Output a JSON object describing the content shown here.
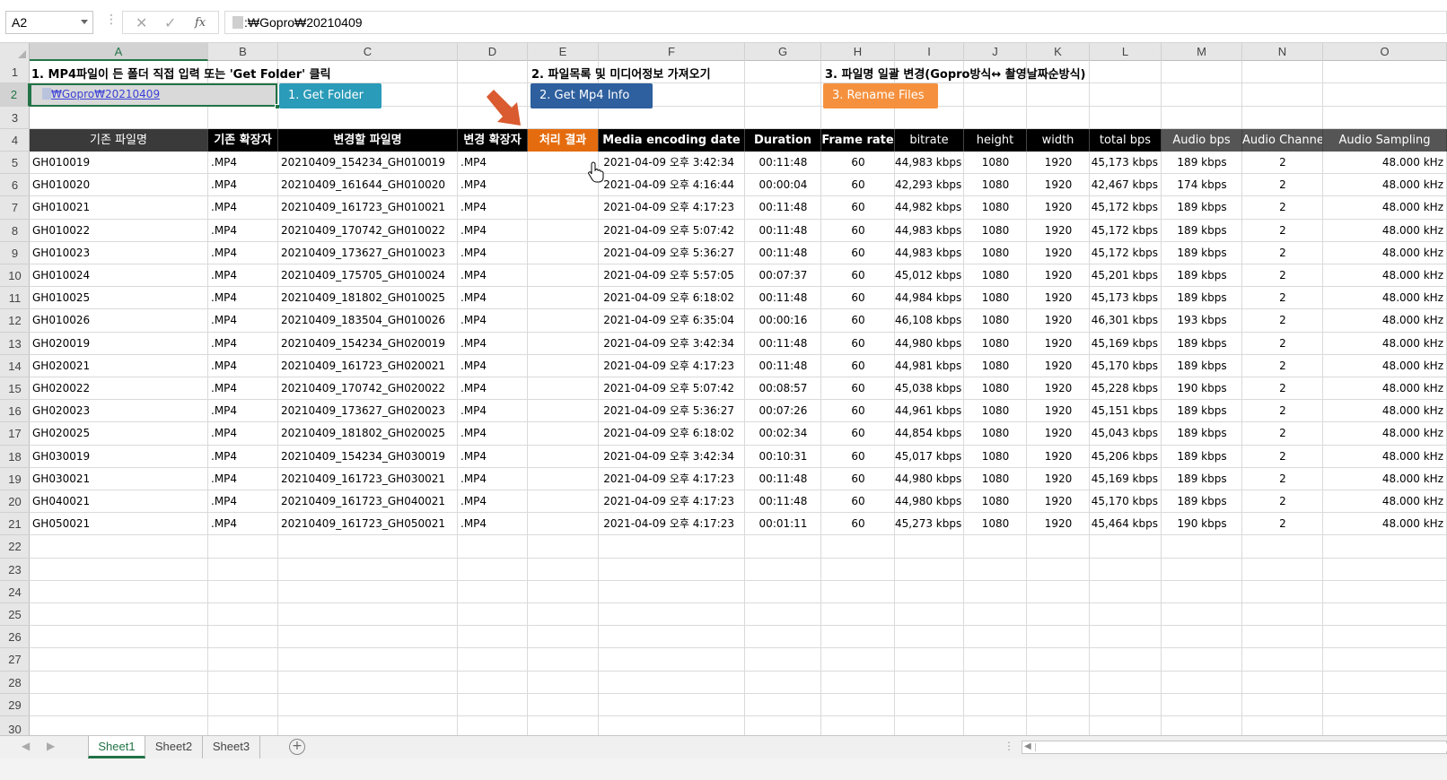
{
  "formula_bar": {
    "name_box": "A2",
    "formula": ":₩Gopro₩20210409",
    "cancel_icon": "✕",
    "enter_icon": "✓",
    "fx_icon": "fx"
  },
  "column_headers": [
    "A",
    "B",
    "C",
    "D",
    "E",
    "F",
    "G",
    "H",
    "I",
    "J",
    "K",
    "L",
    "M",
    "N",
    "O"
  ],
  "selected_column": "A",
  "row_numbers": [
    "1",
    "2",
    "3",
    "4",
    "5",
    "6",
    "7",
    "8",
    "9",
    "10",
    "11",
    "12",
    "13",
    "14",
    "15",
    "16",
    "17",
    "18",
    "19",
    "20",
    "21",
    "22",
    "23",
    "24",
    "25",
    "26",
    "27",
    "28",
    "29",
    "30"
  ],
  "selected_row": "2",
  "sections": {
    "step1": "1. MP4파일이 든 폴더 직접 입력 또는 'Get Folder' 클릭",
    "step2": "2. 파일목록 및 미디어정보 가져오기",
    "step3": "3. 파일명 일괄 변경(Gopro방식↔ 촬영날짜순방식)"
  },
  "a2_value": "₩Gopro₩20210409",
  "buttons": {
    "get_folder": "1. Get Folder",
    "get_mp4_info": "2. Get Mp4 Info",
    "rename_files": "3. Rename Files"
  },
  "table_headers": {
    "orig_name": "기존 파일명",
    "orig_ext": "기존 확장자",
    "new_name": "변경할 파일명",
    "new_ext": "변경 확장자",
    "result": "처리 결과",
    "media_date": "Media encoding date",
    "duration": "Duration",
    "frame_rate": "Frame rate",
    "bitrate": "bitrate",
    "height": "height",
    "width": "width",
    "total_bps": "total bps",
    "audio_bps": "Audio bps",
    "audio_channel": "Audio Channel",
    "audio_sampling": "Audio Sampling"
  },
  "rows": [
    [
      "GH010019",
      ".MP4",
      "20210409_154234_GH010019",
      ".MP4",
      "",
      "2021-04-09 오후 3:42:34",
      "00:11:48",
      "60",
      "44,983 kbps",
      "1080",
      "1920",
      "45,173 kbps",
      "189 kbps",
      "2",
      "48.000 kHz"
    ],
    [
      "GH010020",
      ".MP4",
      "20210409_161644_GH010020",
      ".MP4",
      "",
      "2021-04-09 오후 4:16:44",
      "00:00:04",
      "60",
      "42,293 kbps",
      "1080",
      "1920",
      "42,467 kbps",
      "174 kbps",
      "2",
      "48.000 kHz"
    ],
    [
      "GH010021",
      ".MP4",
      "20210409_161723_GH010021",
      ".MP4",
      "",
      "2021-04-09 오후 4:17:23",
      "00:11:48",
      "60",
      "44,982 kbps",
      "1080",
      "1920",
      "45,172 kbps",
      "189 kbps",
      "2",
      "48.000 kHz"
    ],
    [
      "GH010022",
      ".MP4",
      "20210409_170742_GH010022",
      ".MP4",
      "",
      "2021-04-09 오후 5:07:42",
      "00:11:48",
      "60",
      "44,983 kbps",
      "1080",
      "1920",
      "45,172 kbps",
      "189 kbps",
      "2",
      "48.000 kHz"
    ],
    [
      "GH010023",
      ".MP4",
      "20210409_173627_GH010023",
      ".MP4",
      "",
      "2021-04-09 오후 5:36:27",
      "00:11:48",
      "60",
      "44,983 kbps",
      "1080",
      "1920",
      "45,172 kbps",
      "189 kbps",
      "2",
      "48.000 kHz"
    ],
    [
      "GH010024",
      ".MP4",
      "20210409_175705_GH010024",
      ".MP4",
      "",
      "2021-04-09 오후 5:57:05",
      "00:07:37",
      "60",
      "45,012 kbps",
      "1080",
      "1920",
      "45,201 kbps",
      "189 kbps",
      "2",
      "48.000 kHz"
    ],
    [
      "GH010025",
      ".MP4",
      "20210409_181802_GH010025",
      ".MP4",
      "",
      "2021-04-09 오후 6:18:02",
      "00:11:48",
      "60",
      "44,984 kbps",
      "1080",
      "1920",
      "45,173 kbps",
      "189 kbps",
      "2",
      "48.000 kHz"
    ],
    [
      "GH010026",
      ".MP4",
      "20210409_183504_GH010026",
      ".MP4",
      "",
      "2021-04-09 오후 6:35:04",
      "00:00:16",
      "60",
      "46,108 kbps",
      "1080",
      "1920",
      "46,301 kbps",
      "193 kbps",
      "2",
      "48.000 kHz"
    ],
    [
      "GH020019",
      ".MP4",
      "20210409_154234_GH020019",
      ".MP4",
      "",
      "2021-04-09 오후 3:42:34",
      "00:11:48",
      "60",
      "44,980 kbps",
      "1080",
      "1920",
      "45,169 kbps",
      "189 kbps",
      "2",
      "48.000 kHz"
    ],
    [
      "GH020021",
      ".MP4",
      "20210409_161723_GH020021",
      ".MP4",
      "",
      "2021-04-09 오후 4:17:23",
      "00:11:48",
      "60",
      "44,981 kbps",
      "1080",
      "1920",
      "45,170 kbps",
      "189 kbps",
      "2",
      "48.000 kHz"
    ],
    [
      "GH020022",
      ".MP4",
      "20210409_170742_GH020022",
      ".MP4",
      "",
      "2021-04-09 오후 5:07:42",
      "00:08:57",
      "60",
      "45,038 kbps",
      "1080",
      "1920",
      "45,228 kbps",
      "190 kbps",
      "2",
      "48.000 kHz"
    ],
    [
      "GH020023",
      ".MP4",
      "20210409_173627_GH020023",
      ".MP4",
      "",
      "2021-04-09 오후 5:36:27",
      "00:07:26",
      "60",
      "44,961 kbps",
      "1080",
      "1920",
      "45,151 kbps",
      "189 kbps",
      "2",
      "48.000 kHz"
    ],
    [
      "GH020025",
      ".MP4",
      "20210409_181802_GH020025",
      ".MP4",
      "",
      "2021-04-09 오후 6:18:02",
      "00:02:34",
      "60",
      "44,854 kbps",
      "1080",
      "1920",
      "45,043 kbps",
      "189 kbps",
      "2",
      "48.000 kHz"
    ],
    [
      "GH030019",
      ".MP4",
      "20210409_154234_GH030019",
      ".MP4",
      "",
      "2021-04-09 오후 3:42:34",
      "00:10:31",
      "60",
      "45,017 kbps",
      "1080",
      "1920",
      "45,206 kbps",
      "189 kbps",
      "2",
      "48.000 kHz"
    ],
    [
      "GH030021",
      ".MP4",
      "20210409_161723_GH030021",
      ".MP4",
      "",
      "2021-04-09 오후 4:17:23",
      "00:11:48",
      "60",
      "44,980 kbps",
      "1080",
      "1920",
      "45,169 kbps",
      "189 kbps",
      "2",
      "48.000 kHz"
    ],
    [
      "GH040021",
      ".MP4",
      "20210409_161723_GH040021",
      ".MP4",
      "",
      "2021-04-09 오후 4:17:23",
      "00:11:48",
      "60",
      "44,980 kbps",
      "1080",
      "1920",
      "45,170 kbps",
      "189 kbps",
      "2",
      "48.000 kHz"
    ],
    [
      "GH050021",
      ".MP4",
      "20210409_161723_GH050021",
      ".MP4",
      "",
      "2021-04-09 오후 4:17:23",
      "00:01:11",
      "60",
      "45,273 kbps",
      "1080",
      "1920",
      "45,464 kbps",
      "190 kbps",
      "2",
      "48.000 kHz"
    ]
  ],
  "sheet_tabs": [
    "Sheet1",
    "Sheet2",
    "Sheet3"
  ],
  "active_sheet": "Sheet1",
  "add_sheet_icon": "+",
  "colors": {
    "excel_green": "#217346",
    "get_folder_button": "#2a9bb8",
    "get_mp4_button": "#2e5f9e",
    "rename_button": "#f5913e",
    "result_header": "#e56c0e",
    "arrow": "#d95b2f"
  }
}
